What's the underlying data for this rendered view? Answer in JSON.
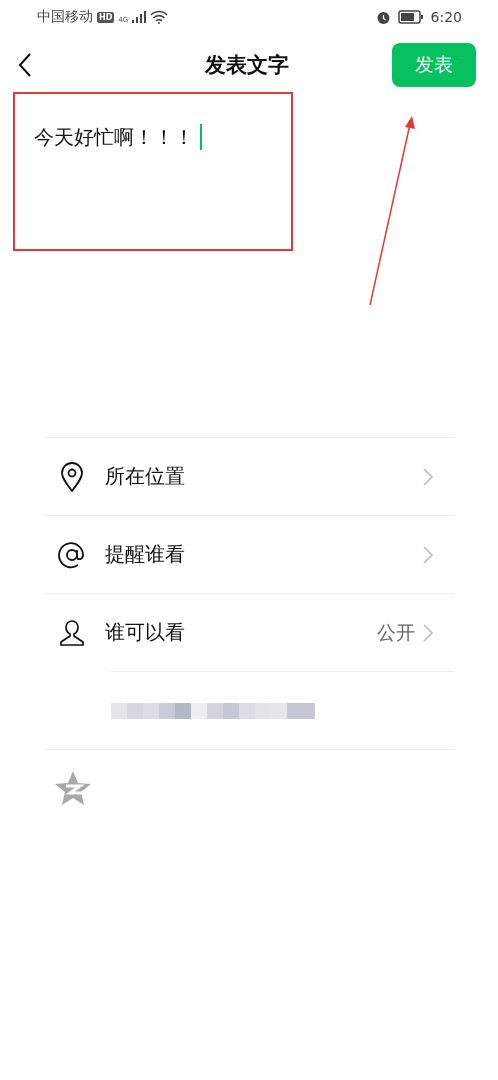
{
  "status_bar": {
    "carrier": "中国移动",
    "hd": "HD",
    "network": "4G",
    "time": "6:20"
  },
  "header": {
    "title": "发表文字",
    "publish_button": "发表"
  },
  "post": {
    "value": "今天好忙啊！！！"
  },
  "options": [
    {
      "kind": "location",
      "label": "所在位置"
    },
    {
      "kind": "mention",
      "label": "提醒谁看"
    },
    {
      "kind": "visibility",
      "label": "谁可以看",
      "value": "公开"
    }
  ]
}
